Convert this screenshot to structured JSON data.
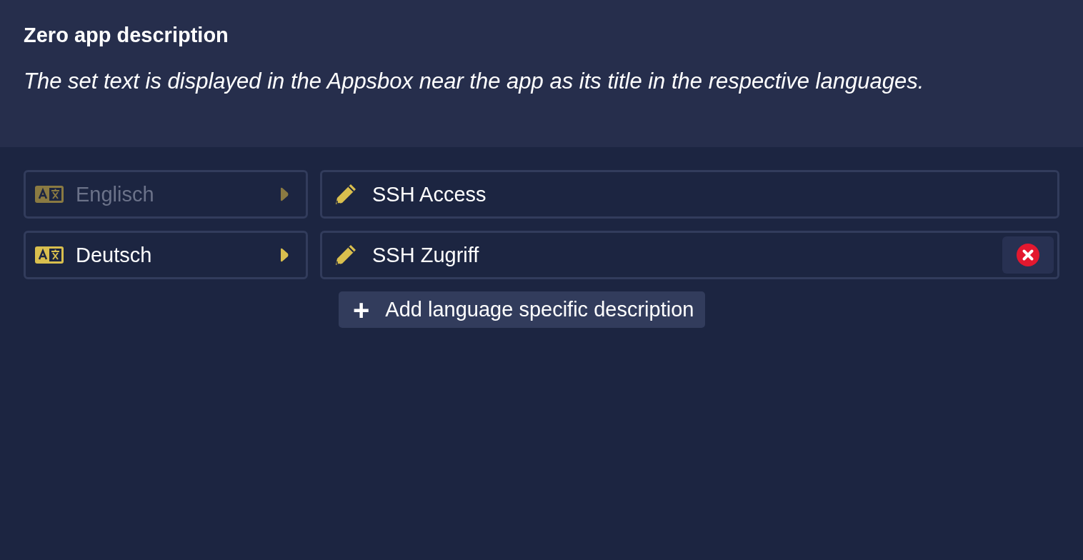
{
  "header": {
    "title": "Zero app description",
    "description": "The set text is displayed in the Appsbox near the app as its title in the respective languages."
  },
  "rows": [
    {
      "language": "Englisch",
      "disabled": true,
      "value": "SSH Access",
      "deletable": false
    },
    {
      "language": "Deutsch",
      "disabled": false,
      "value": "SSH Zugriff",
      "deletable": true
    }
  ],
  "add_button": {
    "icon": "+",
    "label": "Add language specific description"
  }
}
